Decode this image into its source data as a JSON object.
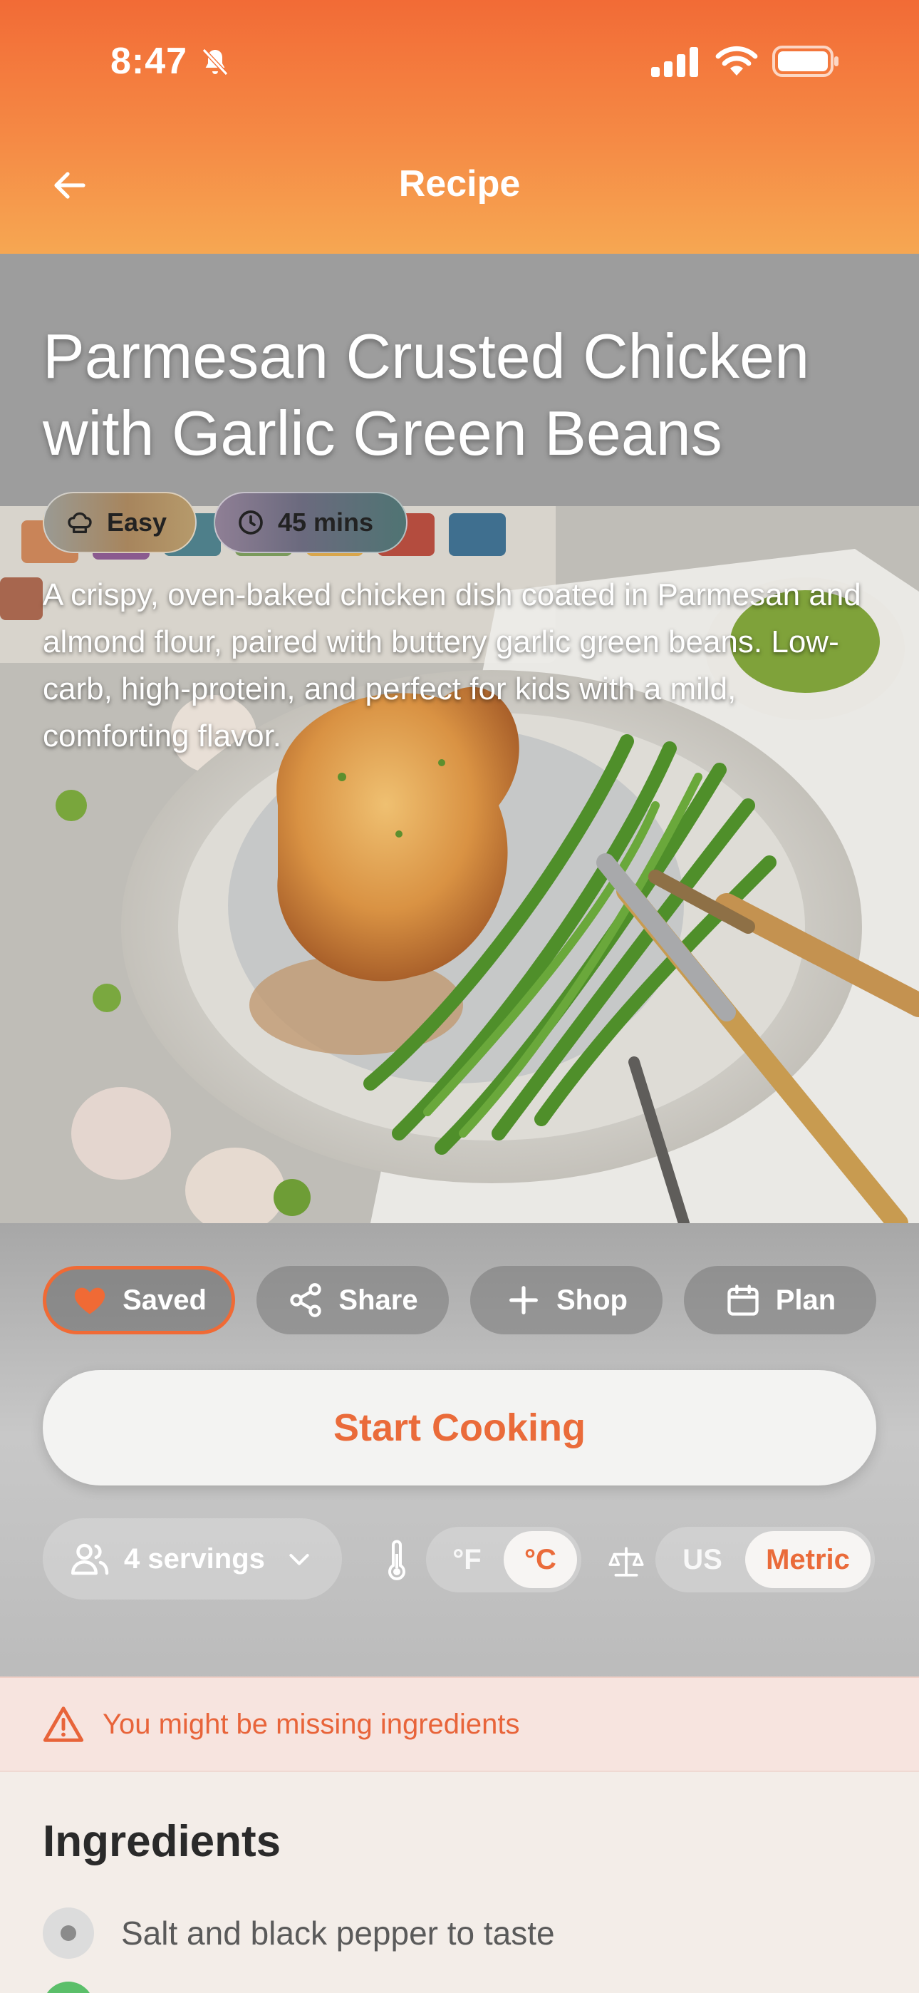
{
  "status_bar": {
    "time": "8:47"
  },
  "header": {
    "title": "Recipe"
  },
  "recipe": {
    "title": "Parmesan Crusted Chicken with Garlic Green Beans",
    "difficulty": "Easy",
    "duration": "45 mins",
    "description": "A crispy, oven-baked chicken dish coated in Parmesan and almond flour, paired with buttery garlic green beans. Low-carb, high-protein, and perfect for kids with a mild, comforting flavor."
  },
  "actions": {
    "saved": "Saved",
    "share": "Share",
    "shop": "Shop",
    "plan": "Plan",
    "start_cooking": "Start Cooking"
  },
  "settings": {
    "servings": "4 servings",
    "temp_f": "°F",
    "temp_c": "°C",
    "temp_selected": "°C",
    "unit_us": "US",
    "unit_metric": "Metric",
    "unit_selected": "Metric"
  },
  "warning": {
    "text": "You might be missing ingredients"
  },
  "ingredients": {
    "title": "Ingredients",
    "items": [
      {
        "label": "Salt and black pepper to taste",
        "status": "missing"
      }
    ]
  },
  "colors": {
    "accent": "#ea6b3a",
    "header_top": "#f26b36",
    "header_bottom": "#f6a752",
    "warning_bg": "#f7e4df",
    "available": "#5bbf6a"
  },
  "icons": [
    "bell-slash-icon",
    "signal-icon",
    "wifi-icon",
    "battery-icon",
    "back-arrow-icon",
    "chef-hat-icon",
    "clock-icon",
    "heart-icon",
    "share-icon",
    "plus-icon",
    "calendar-icon",
    "people-icon",
    "chevron-down-icon",
    "thermometer-icon",
    "scale-icon",
    "warning-icon"
  ]
}
